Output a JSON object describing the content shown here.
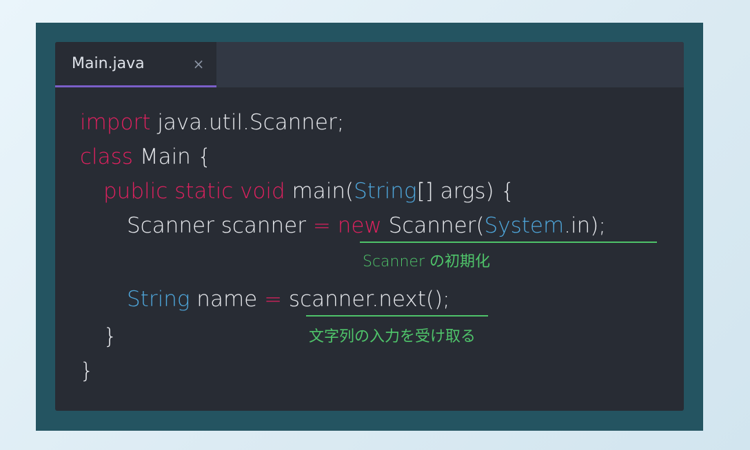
{
  "tab": {
    "filename": "Main.java",
    "close_glyph": "×"
  },
  "code": {
    "line1": {
      "kw": "import",
      "rest": " java.util.Scanner;"
    },
    "line2": {
      "kw": "class",
      "rest": " Main {"
    },
    "line3": {
      "mods": "public static void",
      "mid": " main(",
      "type": "String",
      "rest": "[] args) {"
    },
    "line4": {
      "decl": "Scanner scanner ",
      "eq": "=",
      "sp": " ",
      "kw": "new",
      "ctor": " Scanner(",
      "sys": "System",
      "rest": ".in);"
    },
    "line5": {
      "type": "String",
      "mid": " name ",
      "eq": "=",
      "rest": " scanner.next();"
    },
    "line6": {
      "brace": "}"
    },
    "line7": {
      "brace": "}"
    }
  },
  "annotations": {
    "scanner_init": "Scanner の初期化",
    "read_string": "文字列の入力を受け取る"
  },
  "colors": {
    "keyword": "#e0215f",
    "type": "#4fa7dc",
    "annotation": "#4fc46a",
    "editor_bg": "#282c34",
    "frame_bg": "#245461",
    "tab_accent": "#7b5fc9"
  }
}
